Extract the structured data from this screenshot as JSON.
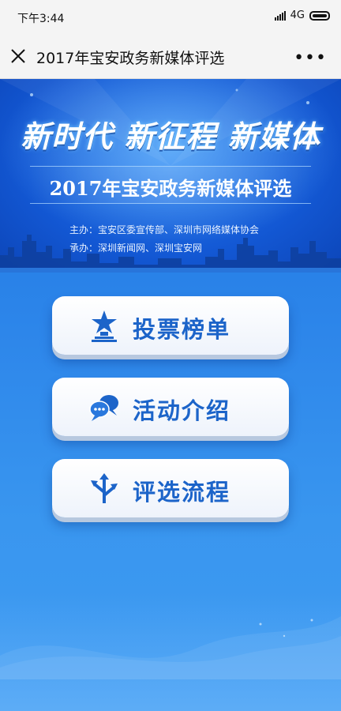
{
  "status_bar": {
    "time": "下午3:44",
    "network": "4G"
  },
  "nav": {
    "title": "2017年宝安政务新媒体评选"
  },
  "banner": {
    "slogan": "新时代 新征程 新媒体",
    "subtitle": "2017年宝安政务新媒体评选",
    "host": "主办：宝安区委宣传部、深圳市网络媒体协会",
    "organizer": "承办：深圳新闻网、深圳宝安网"
  },
  "menu": [
    {
      "label": "投票榜单",
      "icon": "trophy-star-icon"
    },
    {
      "label": "活动介绍",
      "icon": "chat-bubbles-icon"
    },
    {
      "label": "评选流程",
      "icon": "branch-arrows-icon"
    }
  ],
  "colors": {
    "primary_blue": "#1c64c9",
    "background_blue": "#2d86ea"
  }
}
